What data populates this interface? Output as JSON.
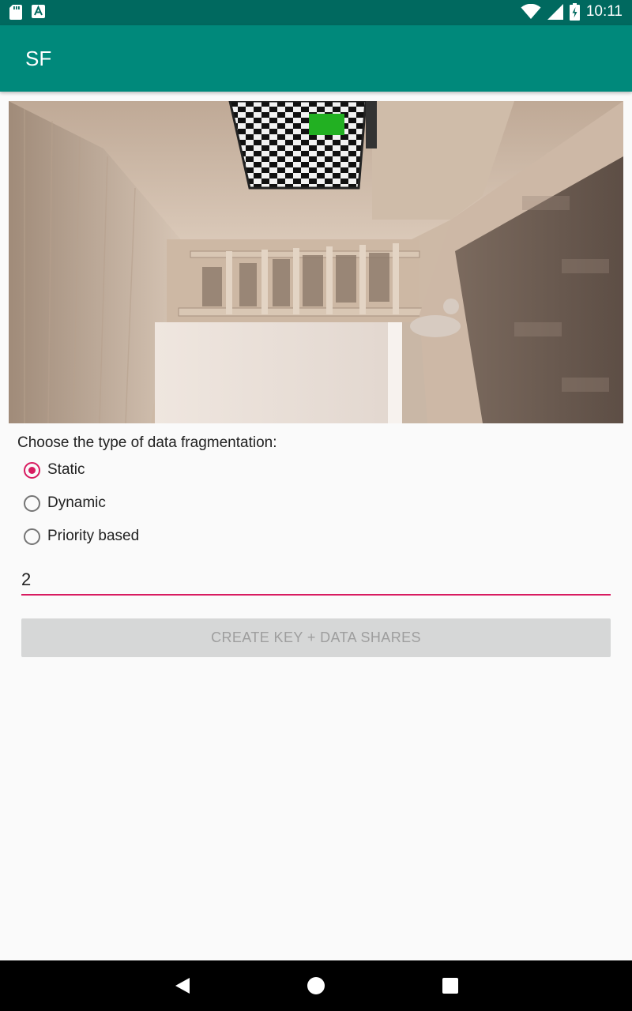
{
  "status_bar": {
    "time": "10:11",
    "left_icons": [
      "sd-card-icon",
      "notification-a-icon"
    ],
    "right_icons": [
      "wifi-icon",
      "cell-signal-icon",
      "battery-charging-icon"
    ]
  },
  "app_bar": {
    "title": "SF"
  },
  "colors": {
    "app_bar": "#00897b",
    "status_bar": "#00695f",
    "accent": "#d81b60"
  },
  "image": {
    "description_icon": "room-photo"
  },
  "fragmentation": {
    "prompt": "Choose the type of data fragmentation:",
    "options": [
      {
        "label": "Static",
        "checked": true
      },
      {
        "label": "Dynamic",
        "checked": false
      },
      {
        "label": "Priority based",
        "checked": false
      }
    ]
  },
  "shares_input": {
    "value": "2"
  },
  "create_button": {
    "label": "CREATE KEY + DATA SHARES",
    "enabled": false
  },
  "nav_bar": {
    "buttons": [
      "back-icon",
      "home-icon",
      "recents-icon"
    ]
  }
}
